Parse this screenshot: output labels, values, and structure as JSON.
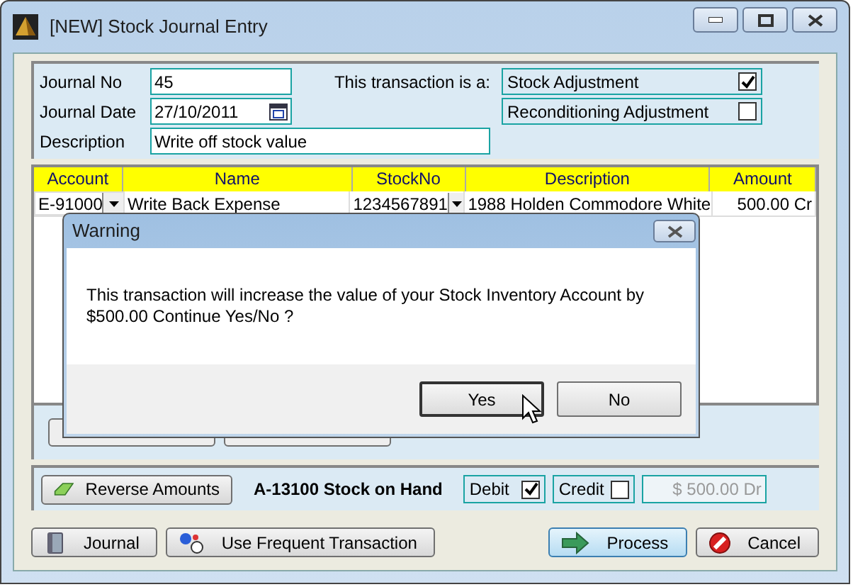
{
  "window": {
    "title": "[NEW] Stock Journal Entry"
  },
  "header": {
    "fields": [
      {
        "label": "Journal No",
        "value": "45",
        "kind": "text"
      },
      {
        "label": "Journal Date",
        "value": "27/10/2011",
        "kind": "date"
      },
      {
        "label": "Description",
        "value": "Write off stock value",
        "kind": "wide"
      }
    ],
    "transaction_label": "This transaction is a:",
    "transaction_types": [
      {
        "label": "Stock Adjustment",
        "checked": true
      },
      {
        "label": "Reconditioning Adjustment",
        "checked": false
      }
    ]
  },
  "grid": {
    "columns": [
      "Account",
      "Name",
      "StockNo",
      "Description",
      "Amount"
    ],
    "rows": [
      {
        "cells": [
          "E-91000",
          "Write Back Expense",
          "1234567891",
          "1988 Holden Commodore  White",
          "500.00 Cr"
        ]
      }
    ]
  },
  "totals": {
    "reverse_button": "Reverse Amounts",
    "account": "A-13100 Stock on Hand",
    "options": [
      {
        "label": "Debit",
        "checked": true
      },
      {
        "label": "Credit",
        "checked": false
      }
    ],
    "amount": "$ 500.00 Dr"
  },
  "footer": {
    "left_buttons": [
      {
        "label": "Journal",
        "kind": "journal"
      },
      {
        "label": "Use Frequent Transaction",
        "kind": "frequent"
      }
    ],
    "right_buttons": [
      {
        "label": "Process",
        "kind": "process",
        "focused": true
      },
      {
        "label": "Cancel",
        "kind": "cancel",
        "focused": false
      }
    ]
  },
  "dialog": {
    "title": "Warning",
    "message": "This transaction will increase the value of your Stock Inventory Account by $500.00 Continue Yes/No ?",
    "buttons": [
      {
        "label": "Yes",
        "focused": true
      },
      {
        "label": "No",
        "focused": false
      }
    ]
  }
}
